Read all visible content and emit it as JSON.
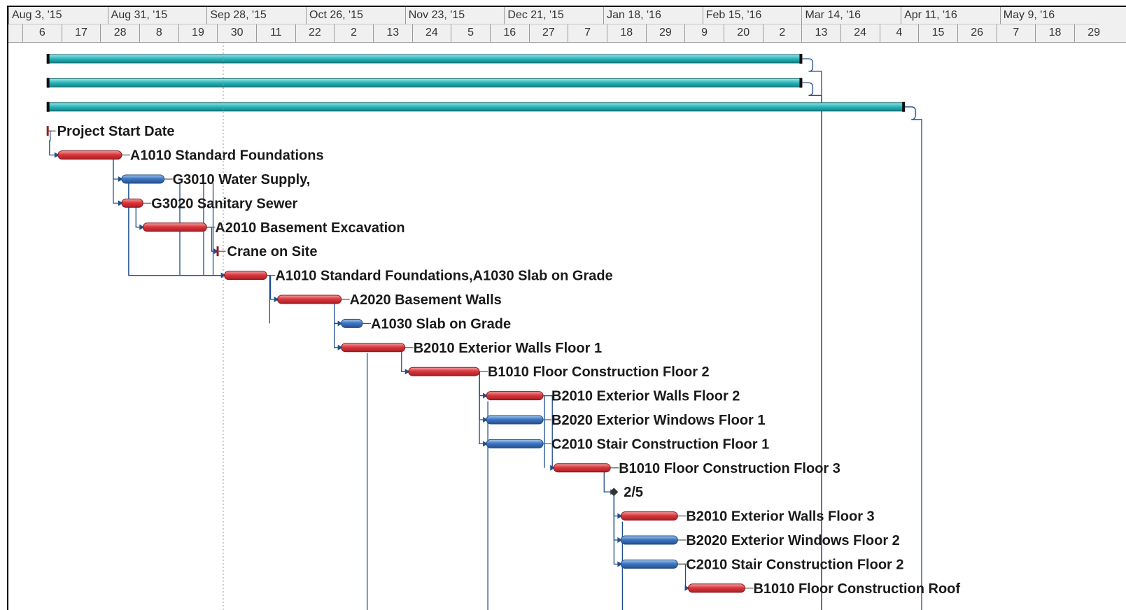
{
  "timescale": {
    "major": [
      "Aug 3, '15",
      "Aug 31, '15",
      "Sep 28, '15",
      "Oct 26, '15",
      "Nov 23, '15",
      "Dec 21, '15",
      "Jan 18, '16",
      "Feb 15, '16",
      "Mar 14, '16",
      "Apr 11, '16",
      "May 9, '16"
    ],
    "minor": [
      "6",
      "17",
      "28",
      "8",
      "19",
      "30",
      "11",
      "22",
      "2",
      "13",
      "24",
      "5",
      "16",
      "27",
      "7",
      "18",
      "29",
      "9",
      "20",
      "2",
      "13",
      "24",
      "4",
      "15",
      "26",
      "7",
      "18",
      "29"
    ]
  },
  "colors": {
    "critical": "#d6343a",
    "noncritical": "#3d77c4",
    "summary": "#29b3b8",
    "link": "#1f4f8c",
    "milestone": "#9b1c1c"
  },
  "tasks": [
    {
      "name": "",
      "kind": "summary",
      "start": "2015-08-14",
      "finish": "2016-03-14"
    },
    {
      "name": "",
      "kind": "summary",
      "start": "2015-08-14",
      "finish": "2016-03-14"
    },
    {
      "name": "",
      "kind": "summary",
      "start": "2015-08-14",
      "finish": "2016-04-12"
    },
    {
      "name": "Project Start Date",
      "kind": "milestone",
      "start": "2015-08-14",
      "finish": "2015-08-14"
    },
    {
      "name": "A1010 Standard Foundations",
      "kind": "critical",
      "start": "2015-08-17",
      "finish": "2015-09-04"
    },
    {
      "name": "G3010 Water Supply,",
      "kind": "noncritical",
      "start": "2015-09-04",
      "finish": "2015-09-16"
    },
    {
      "name": "G3020 Sanitary Sewer",
      "kind": "critical",
      "start": "2015-09-04",
      "finish": "2015-09-10"
    },
    {
      "name": "A2010 Basement Excavation",
      "kind": "critical",
      "start": "2015-09-10",
      "finish": "2015-09-28"
    },
    {
      "name": "Crane on Site",
      "kind": "milestone",
      "start": "2015-10-01",
      "finish": "2015-10-01"
    },
    {
      "name": "A1010 Standard Foundations,A1030 Slab on Grade",
      "kind": "critical",
      "start": "2015-10-03",
      "finish": "2015-10-15"
    },
    {
      "name": "A2020 Basement Walls",
      "kind": "critical",
      "start": "2015-10-18",
      "finish": "2015-11-05"
    },
    {
      "name": "A1030 Slab on Grade",
      "kind": "noncritical",
      "start": "2015-11-05",
      "finish": "2015-11-11"
    },
    {
      "name": "B2010 Exterior Walls Floor 1",
      "kind": "critical",
      "start": "2015-11-05",
      "finish": "2015-11-23"
    },
    {
      "name": "B1010 Floor Construction Floor 2",
      "kind": "critical",
      "start": "2015-11-24",
      "finish": "2015-12-14"
    },
    {
      "name": "B2010 Exterior Walls Floor 2",
      "kind": "critical",
      "start": "2015-12-16",
      "finish": "2016-01-01"
    },
    {
      "name": "B2020 Exterior Windows Floor 1",
      "kind": "noncritical",
      "start": "2015-12-16",
      "finish": "2016-01-01"
    },
    {
      "name": "C2010 Stair Construction Floor 1",
      "kind": "noncritical",
      "start": "2015-12-16",
      "finish": "2016-01-01"
    },
    {
      "name": "B1010 Floor Construction Floor 3",
      "kind": "critical",
      "start": "2016-01-04",
      "finish": "2016-01-20"
    },
    {
      "name": "2/5",
      "kind": "milestone-diamond",
      "start": "2016-01-21",
      "finish": "2016-01-21"
    },
    {
      "name": "B2010 Exterior Walls Floor 3",
      "kind": "critical",
      "start": "2016-01-23",
      "finish": "2016-02-08"
    },
    {
      "name": "B2020 Exterior Windows Floor 2",
      "kind": "noncritical",
      "start": "2016-01-23",
      "finish": "2016-02-08"
    },
    {
      "name": "C2010 Stair Construction Floor 2",
      "kind": "noncritical",
      "start": "2016-01-23",
      "finish": "2016-02-08"
    },
    {
      "name": "B1010 Floor Construction Roof",
      "kind": "critical",
      "start": "2016-02-11",
      "finish": "2016-02-27"
    }
  ]
}
